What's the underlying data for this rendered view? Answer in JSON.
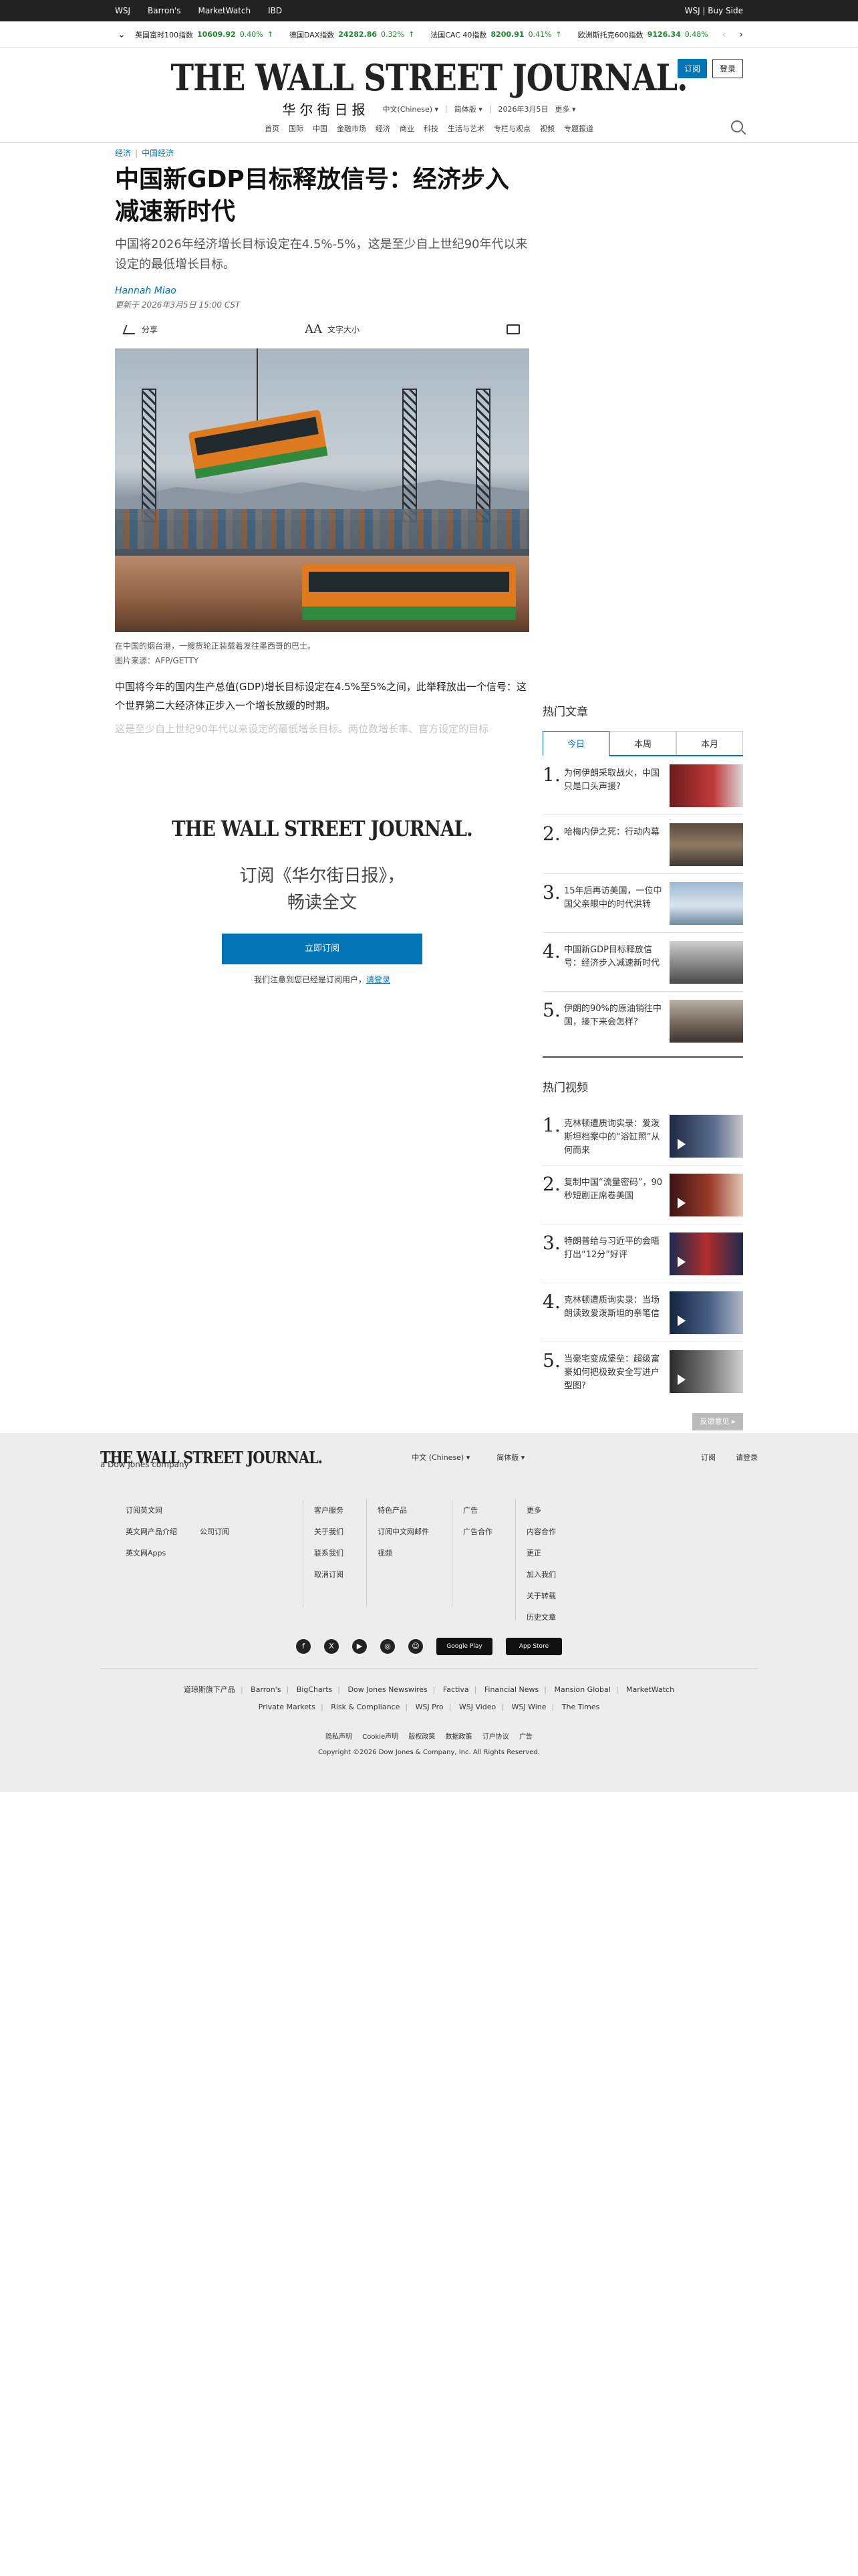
{
  "topbar": {
    "links": [
      "WSJ",
      "Barron's",
      "MarketWatch",
      "IBD"
    ],
    "right": "WSJ | Buy Side"
  },
  "ticker": [
    {
      "name": "英国富时100指数",
      "value": "10609.92",
      "pct": "0.40%"
    },
    {
      "name": "德国DAX指数",
      "value": "24282.86",
      "pct": "0.32%"
    },
    {
      "name": "法国CAC 40指数",
      "value": "8200.91",
      "pct": "0.41%"
    },
    {
      "name": "欧洲斯托克600指数",
      "value": "9126.34",
      "pct": "0.48%"
    }
  ],
  "masthead": {
    "logo": "THE WALL STREET JOURNAL.",
    "cn": "华尔街日报",
    "lang": "中文(Chinese) ▾",
    "script": "简体版 ▾",
    "date": "2026年3月5日",
    "more": "更多 ▾",
    "subscribe": "订阅",
    "login": "登录"
  },
  "nav": [
    "首页",
    "国际",
    "中国",
    "金融市场",
    "经济",
    "商业",
    "科技",
    "生活与艺术",
    "专栏与观点",
    "视频",
    "专题报道"
  ],
  "article": {
    "crumb1": "经济",
    "crumb2": "中国经济",
    "title": "中国新GDP目标释放信号：经济步入减速新时代",
    "dek": "中国将2026年经济增长目标设定在4.5%-5%，这是至少自上世纪90年代以来设定的最低增长目标。",
    "author": "Hannah Miao",
    "updated": "更新于 2026年3月5日 15:00 CST",
    "share": "分享",
    "textsize": "文字大小",
    "caption": "在中国的烟台港，一艘货轮正装载着发往墨西哥的巴士。",
    "credit": "图片来源：AFP/GETTY",
    "para1": "中国将今年的国内生产总值(GDP)增长目标设定在4.5%至5%之间，此举释放出一个信号：这个世界第二大经济体正步入一个增长放缓的时期。",
    "para2_faded": "这是至少自上世纪90年代以来设定的最低增长目标。两位数增长率、官方设定的目标"
  },
  "paywall": {
    "logo": "THE WALL STREET JOURNAL.",
    "line1": "订阅《华尔街日报》，",
    "line2": "畅读全文",
    "button": "立即订阅",
    "note": "我们注意到您已经是订阅用户，",
    "login": "请登录"
  },
  "sidebar": {
    "popular_title": "热门文章",
    "tabs": [
      "今日",
      "本周",
      "本月"
    ],
    "popular": [
      {
        "n": "1.",
        "text": "为何伊朗采取战火，中国只是口头声援?"
      },
      {
        "n": "2.",
        "text": "哈梅内伊之死：行动内幕"
      },
      {
        "n": "3.",
        "text": "15年后再访美国，一位中国父亲眼中的时代洪转"
      },
      {
        "n": "4.",
        "text": "中国新GDP目标释放信号：经济步入减速新时代"
      },
      {
        "n": "5.",
        "text": "伊朗的90%的原油销往中国，接下来会怎样?"
      }
    ],
    "video_title": "热门视频",
    "videos": [
      {
        "n": "1.",
        "text": "克林顿遭质询实录：爱泼斯坦档案中的“浴缸照”从何而来"
      },
      {
        "n": "2.",
        "text": "复制中国“流量密码”，90秒短剧正席卷美国"
      },
      {
        "n": "3.",
        "text": "特朗普给与习近平的会晤打出“12分”好评"
      },
      {
        "n": "4.",
        "text": "克林顿遭质询实录：当场朗读致爱泼斯坦的亲笔信"
      },
      {
        "n": "5.",
        "text": "当豪宅变成堡垒：超级富豪如何把极致安全写进户型图?"
      }
    ],
    "feedback": "反馈意见 ▸"
  },
  "footer": {
    "logo": "THE WALL STREET JOURNAL.",
    "dj": "a Dow Jones company",
    "lang": "中文 (Chinese) ▾",
    "script": "简体版 ▾",
    "subscribe": "订阅",
    "login": "请登录",
    "col1": [
      "订阅英文网",
      "英文网产品介绍",
      "英文网Apps"
    ],
    "col2": [
      "公司订阅"
    ],
    "col3": [
      "客户服务",
      "关于我们",
      "联系我们",
      "取消订阅"
    ],
    "col4": [
      "特色产品",
      "订阅中文网邮件",
      "视频"
    ],
    "col5": [
      "广告",
      "广告合作"
    ],
    "col6": [
      "更多",
      "内容合作",
      "更正",
      "加入我们",
      "关于转载",
      "历史文章"
    ],
    "social": [
      "f",
      "X",
      "▶",
      "◎",
      "☺"
    ],
    "google_play": "Google Play",
    "app_store": "App Store",
    "brands_row1": [
      "道琼斯旗下产品",
      "Barron's",
      "BigCharts",
      "Dow Jones Newswires",
      "Factiva",
      "Financial News",
      "Mansion Global",
      "MarketWatch"
    ],
    "brands_row2": [
      "Private Markets",
      "Risk & Compliance",
      "WSJ Pro",
      "WSJ Video",
      "WSJ Wine",
      "The Times"
    ],
    "legal": [
      "隐私声明",
      "Cookie声明",
      "版权政策",
      "数据政策",
      "订户协议",
      "广告"
    ],
    "copyright": "Copyright ©2026 Dow Jones & Company, Inc. All Rights Reserved."
  },
  "colors": {
    "accent": "#0274b6",
    "up": "#1a8a2a",
    "footer_bg": "#ededed"
  }
}
